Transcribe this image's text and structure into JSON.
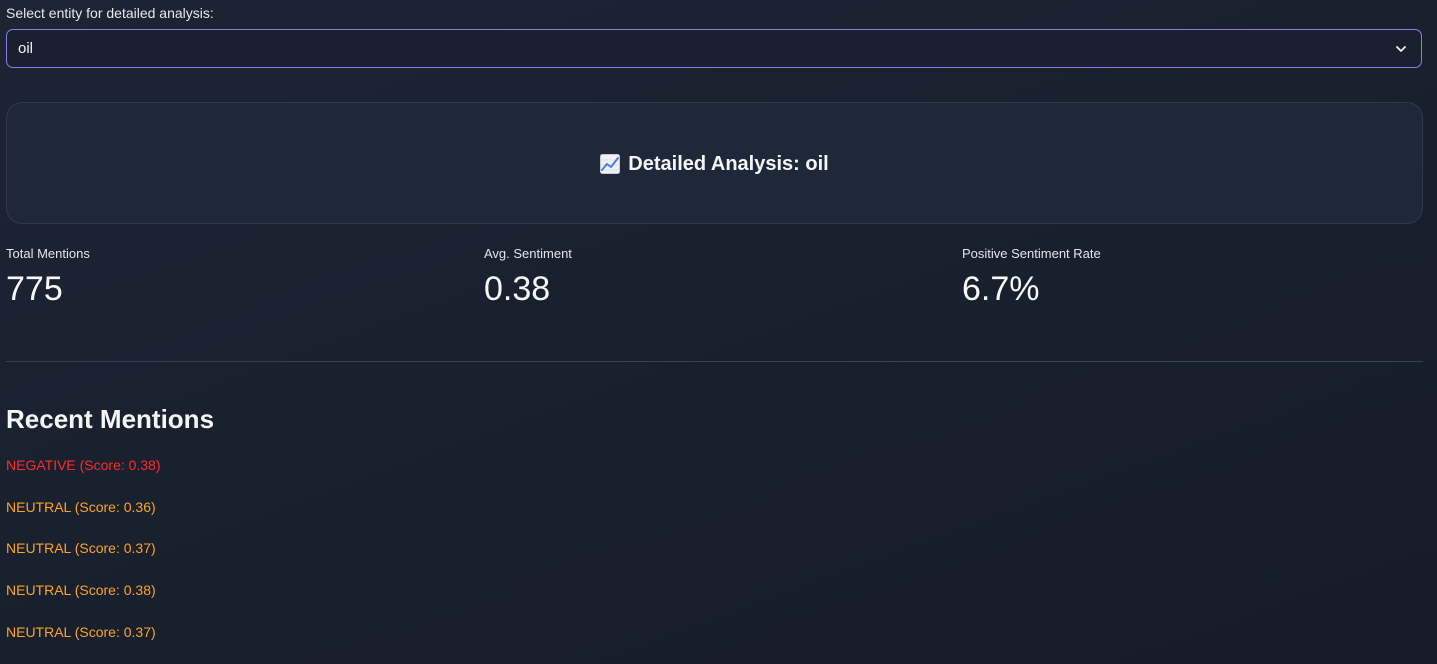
{
  "entity_select": {
    "label": "Select entity for detailed analysis:",
    "value": "oil",
    "chevron_icon": "chevron-down-icon"
  },
  "header": {
    "icon": "chart-increasing-icon",
    "title": "Detailed Analysis: oil"
  },
  "metrics": [
    {
      "label": "Total Mentions",
      "value": "775"
    },
    {
      "label": "Avg. Sentiment",
      "value": "0.38"
    },
    {
      "label": "Positive Sentiment Rate",
      "value": "6.7%"
    }
  ],
  "recent_mentions": {
    "title": "Recent Mentions",
    "items": [
      {
        "text": "NEGATIVE (Score: 0.38)",
        "color": "#ff2b2b"
      },
      {
        "text": "NEUTRAL (Score: 0.36)",
        "color": "#ffa421"
      },
      {
        "text": "NEUTRAL (Score: 0.37)",
        "color": "#ffa421"
      },
      {
        "text": "NEUTRAL (Score: 0.38)",
        "color": "#ffa421"
      },
      {
        "text": "NEUTRAL (Score: 0.37)",
        "color": "#ffa421"
      }
    ]
  }
}
